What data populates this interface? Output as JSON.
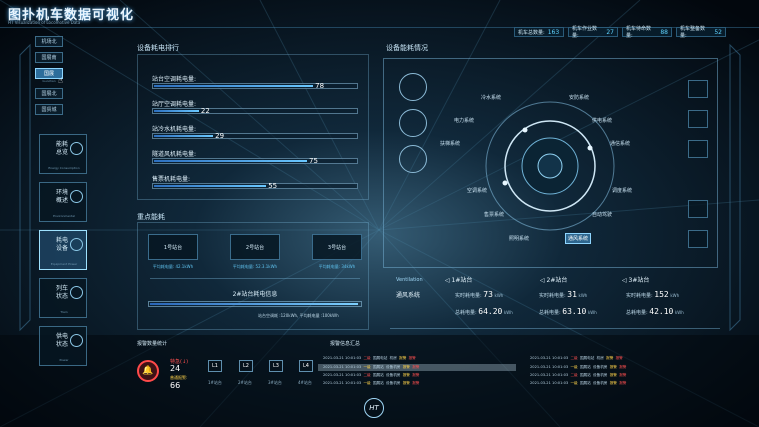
{
  "app": {
    "title": "图扑机车数据可视化",
    "subtitle": "HT Visualization of Locomotive Data"
  },
  "stats": [
    {
      "label": "机车总数量:",
      "value": "163"
    },
    {
      "label": "机车作业数量:",
      "value": "27"
    },
    {
      "label": "机车待命数量:",
      "value": "88"
    },
    {
      "label": "机车整备数量:",
      "value": "52"
    }
  ],
  "cities": [
    {
      "label": "机场北",
      "sub": ""
    },
    {
      "label": "国展南",
      "sub": ""
    },
    {
      "label": "国展",
      "sub": "Guozhan"
    },
    {
      "label": "国展北",
      "sub": ""
    },
    {
      "label": "国贸城",
      "sub": ""
    }
  ],
  "modules": [
    {
      "title_1": "能耗",
      "title_2": "总览",
      "sub": "Energy Consumption"
    },
    {
      "title_1": "环境",
      "title_2": "概述",
      "sub": "Environmental"
    },
    {
      "title_1": "耗电",
      "title_2": "设备",
      "sub": "Equipment Power"
    },
    {
      "title_1": "列车",
      "title_2": "状态",
      "sub": "Train"
    },
    {
      "title_1": "供电",
      "title_2": "状态",
      "sub": "Power"
    }
  ],
  "ranking": {
    "title": "设备耗电排行",
    "items": [
      {
        "label": "站台空调耗电量:",
        "value": 78
      },
      {
        "label": "站厅空调耗电量:",
        "value": 22
      },
      {
        "label": "站冷水机耗电量:",
        "value": 29
      },
      {
        "label": "隧道风机耗电量:",
        "value": 75
      },
      {
        "label": "售票机耗电量:",
        "value": 55
      }
    ]
  },
  "key_energy": {
    "title": "重点能耗",
    "zones": [
      {
        "name": "1号站台",
        "info": "平均耗电量: 42.1kWh"
      },
      {
        "name": "2号站台",
        "info": "平均耗电量: 52.3.1kWh"
      },
      {
        "name": "3号站台",
        "info": "平均耗电量: 34kWh"
      }
    ],
    "detail_title": "2#站台耗电信息",
    "detail_text": "站台空调耗 :120kWh, 平均耗电量 :100kWh"
  },
  "device": {
    "title": "设备能耗情况",
    "systems": [
      "冷水系统",
      "安防系统",
      "电力系统",
      "供电系统",
      "扶梯系统",
      "通信系统",
      "空调系统",
      "调度系统",
      "售票系统",
      "自动驾驶",
      "照明系统",
      "通风系统"
    ],
    "selected": "通风系统"
  },
  "ventilation": {
    "tag": "Ventilation",
    "system": "通风系统",
    "stations": [
      {
        "name": "1#站台",
        "real_label": "实时耗电量:",
        "real": "73",
        "real_unit": "kWh",
        "total_label": "总耗电量:",
        "total": "64.20",
        "total_unit": "kWh"
      },
      {
        "name": "2#站台",
        "real_label": "实时耗电量:",
        "real": "31",
        "real_unit": "kWh",
        "total_label": "总耗电量:",
        "total": "63.10",
        "total_unit": "kWh"
      },
      {
        "name": "3#站台",
        "real_label": "实时耗电量:",
        "real": "152",
        "real_unit": "kWh",
        "total_label": "总耗电量:",
        "total": "42.10",
        "total_unit": "kWh"
      }
    ]
  },
  "alarm": {
    "title": "报警数量统计",
    "major_label": "特急(↓)",
    "major_value": "24",
    "minor_label": "普通报警:",
    "minor_value": "66",
    "lines": [
      {
        "code": "L1",
        "name": "1#站台"
      },
      {
        "code": "L2",
        "name": "2#站台"
      },
      {
        "code": "L3",
        "name": "3#站台"
      },
      {
        "code": "L4",
        "name": "4#站台"
      }
    ]
  },
  "logs": {
    "title": "报警信息汇总",
    "left": [
      {
        "time": "2021-03-21 10:01:03",
        "level": "二级",
        "place": "国展电站",
        "dev": "机房",
        "type": "报警",
        "state": "报警"
      },
      {
        "time": "2021-03-21 10:01:03",
        "level": "一级",
        "place": "国展站",
        "dev": "设备机房",
        "type": "报警",
        "state": "报警"
      },
      {
        "time": "2021-03-21 10:01:03",
        "level": "二级",
        "place": "国展站",
        "dev": "设备机房",
        "type": "报警",
        "state": "报警"
      },
      {
        "time": "2021-03-21 10:01:03",
        "level": "一级",
        "place": "国展站",
        "dev": "设备机房",
        "type": "报警",
        "state": "报警"
      }
    ],
    "right": [
      {
        "time": "2021-03-21 10:01:03",
        "level": "二级",
        "place": "国展电站",
        "dev": "机房",
        "type": "报警",
        "state": "报警"
      },
      {
        "time": "2021-03-21 10:01:03",
        "level": "一级",
        "place": "国展站",
        "dev": "设备机房",
        "type": "报警",
        "state": "报警"
      },
      {
        "time": "2021-03-21 10:01:03",
        "level": "二级",
        "place": "国展站",
        "dev": "设备机房",
        "type": "报警",
        "state": "报警"
      },
      {
        "time": "2021-03-21 10:01:03",
        "level": "一级",
        "place": "国展站",
        "dev": "设备机房",
        "type": "报警",
        "state": "报警"
      }
    ]
  },
  "footer": {
    "logo": "HT"
  },
  "colors": {
    "accent": "#5fd3ff",
    "alarm": "#ff5050",
    "warn": "#ffd34a",
    "panel_border": "#7ab4d7"
  }
}
